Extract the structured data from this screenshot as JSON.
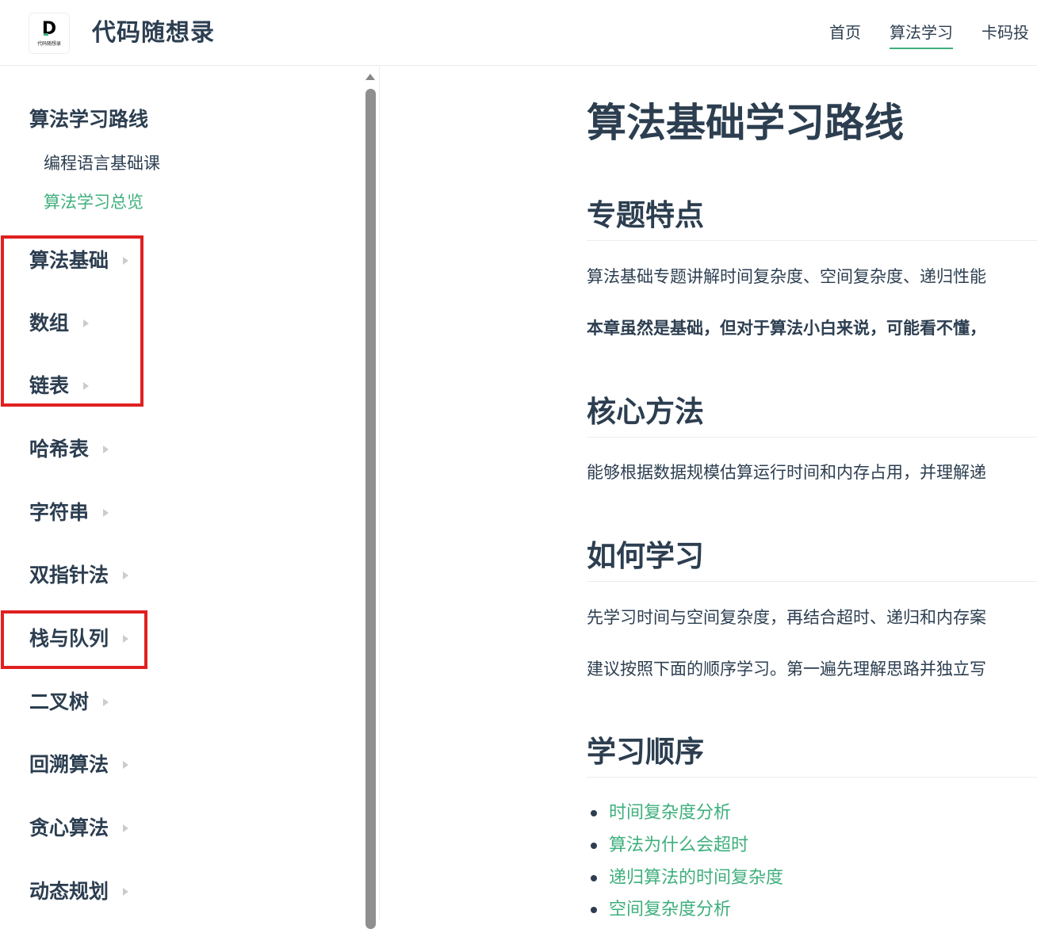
{
  "header": {
    "logo_letter": "D",
    "logo_text": "代码随想录",
    "site_name": "代码随想录",
    "nav": [
      {
        "label": "首页",
        "active": false
      },
      {
        "label": "算法学习",
        "active": true
      },
      {
        "label": "卡码投",
        "active": false
      }
    ]
  },
  "sidebar": {
    "title": "算法学习路线",
    "links": [
      {
        "label": "编程语言基础课",
        "active": false
      },
      {
        "label": "算法学习总览",
        "active": true
      }
    ],
    "groups": [
      "算法基础",
      "数组",
      "链表",
      "哈希表",
      "字符串",
      "双指针法",
      "栈与队列",
      "二叉树",
      "回溯算法",
      "贪心算法",
      "动态规划"
    ]
  },
  "content": {
    "title": "算法基础学习路线",
    "sections": {
      "features": {
        "heading": "专题特点",
        "p1": "算法基础专题讲解时间复杂度、空间复杂度、递归性能",
        "p2": "本章虽然是基础，但对于算法小白来说，可能看不懂，"
      },
      "method": {
        "heading": "核心方法",
        "p1": "能够根据数据规模估算运行时间和内存占用，并理解递"
      },
      "howto": {
        "heading": "如何学习",
        "p1": "先学习时间与空间复杂度，再结合超时、递归和内存案",
        "p2": "建议按照下面的顺序学习。第一遍先理解思路并独立写"
      },
      "order": {
        "heading": "学习顺序",
        "items": [
          "时间复杂度分析",
          "算法为什么会超时",
          "递归算法的时间复杂度",
          "空间复杂度分析"
        ]
      }
    }
  },
  "colors": {
    "accent": "#3eaf7c",
    "text": "#2c3e50",
    "highlight": "#e02020"
  }
}
